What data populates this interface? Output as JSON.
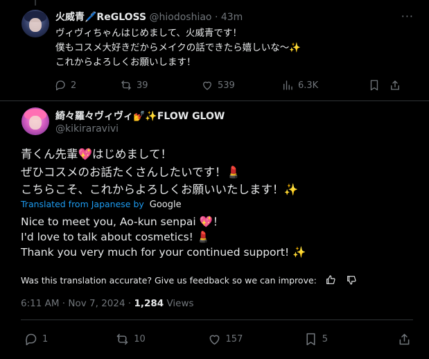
{
  "parent": {
    "display_name": "火威青🖊️ReGLOSS",
    "handle": "@hiodoshiao",
    "separator": "·",
    "time": "43m",
    "more": "···",
    "text": "ヴィヴィちゃんはじめまして、火威青です！\n僕もコスメ大好きだからメイクの話できたら嬉しいな〜✨\nこれからよろしくお願いします！",
    "stats": {
      "replies": "2",
      "reposts": "39",
      "likes": "539",
      "views": "6.3K"
    }
  },
  "main": {
    "display_name": "綺々羅々ヴィヴィ💅✨FLOW GLOW",
    "handle": "@kikiraravivi",
    "text": "青くん先輩💖はじめまして！\nぜひコスメのお話たくさんしたいです！💄\nこちらこそ、これからよろしくお願いいたします！✨",
    "translated_label": "Translated from Japanese by",
    "translator": "Google",
    "translation": "Nice to meet you, Ao-kun senpai 💖！\nI'd love to talk about cosmetics! 💄\nThank you very much for your continued support! ✨",
    "feedback_prompt": "Was this translation accurate? Give us feedback so we can improve:",
    "time": "6:11 AM",
    "date": "Nov 7, 2024",
    "separator": "·",
    "views_count": "1,284",
    "views_label": "Views",
    "stats": {
      "replies": "1",
      "reposts": "10",
      "likes": "157",
      "bookmarks": "5"
    }
  }
}
